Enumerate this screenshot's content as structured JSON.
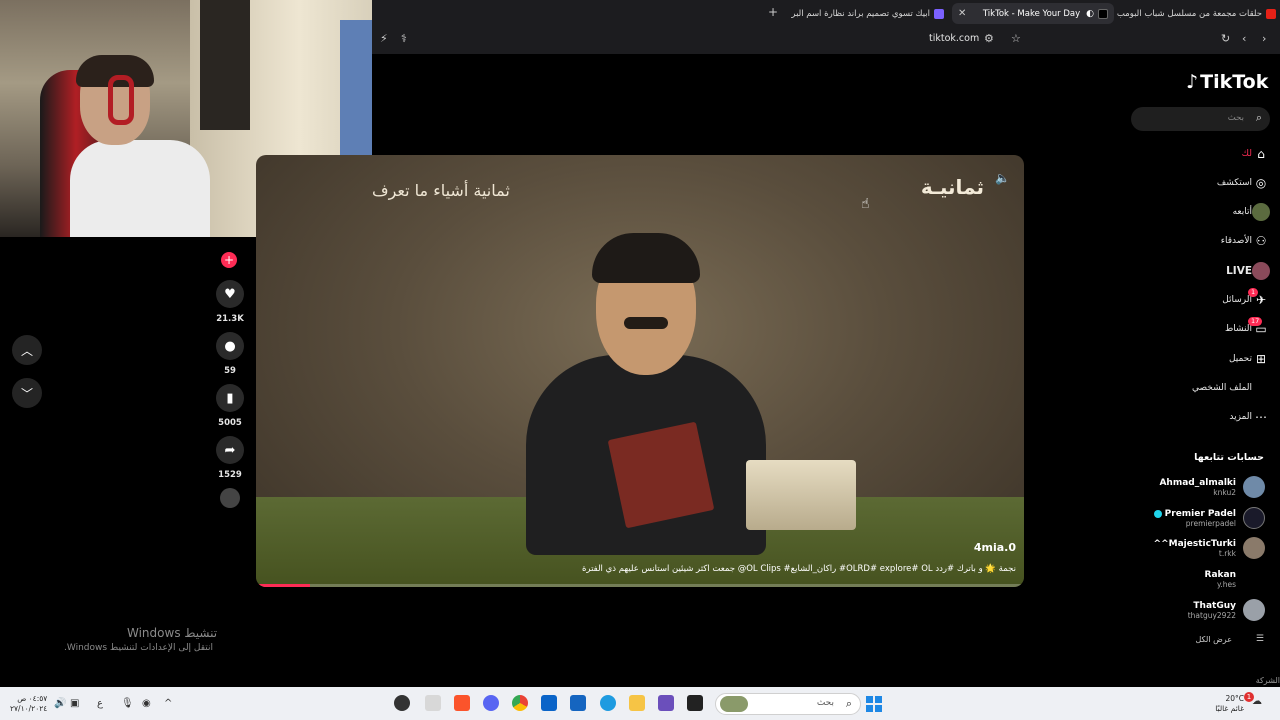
{
  "browser": {
    "tabs": [
      {
        "label": "حلقات مجمعة من مسلسل شباب البومب",
        "active": false
      },
      {
        "label": "TikTok - Make Your Day",
        "active": true
      },
      {
        "label": "ابيك تسوي تصميم براند نظارة اسم البر",
        "active": false
      }
    ],
    "new_tab": "+",
    "url": "tiktok.com"
  },
  "video": {
    "caption_left": "ثمانية أشياء ما تعرف",
    "caption_right": "ثمانيـة",
    "author": "4mia.0",
    "description": "نجمة 🌟 و باترك #ردد OLRD# explore# OL# راكان_الشايع# OL Clips@ جمعت اكثر شيئين استانس عليهم ذي الفترة",
    "progress": 0.07
  },
  "actions": {
    "likes": "21.3K",
    "comments": "59",
    "saves": "5005",
    "shares": "1529"
  },
  "sidebar": {
    "logo": "TikTok",
    "search_placeholder": "بحث",
    "nav": [
      {
        "label": "لك",
        "icon": "home-icon"
      },
      {
        "label": "استكشف",
        "icon": "compass-icon"
      },
      {
        "label": "أتابعه",
        "icon": "following-avatar-icon"
      },
      {
        "label": "الأصدقاء",
        "icon": "friends-icon"
      },
      {
        "label": "LIVE",
        "icon": "live-icon"
      },
      {
        "label": "الرسائل",
        "icon": "messages-icon",
        "badge": "1"
      },
      {
        "label": "النشاط",
        "icon": "inbox-icon",
        "badge": "17"
      },
      {
        "label": "تحميل",
        "icon": "upload-icon"
      },
      {
        "label": "الملف الشخصي",
        "icon": "profile-icon"
      },
      {
        "label": "المزيد",
        "icon": "more-icon"
      }
    ],
    "following_title": "حسابات تتابعها",
    "accounts": [
      {
        "name": "Ahmad_almalki",
        "handle": "knku2"
      },
      {
        "name": "Premier Padel",
        "handle": "premierpadel"
      },
      {
        "name": "^^MajesticTurki",
        "handle": "t.rkk"
      },
      {
        "name": "Rakan",
        "handle": "y.hes"
      },
      {
        "name": "ThatGuy",
        "handle": "thatguy2922"
      }
    ],
    "show_all": "عرض الكل",
    "company": "الشركة"
  },
  "windows": {
    "activate_title": "تنشيط Windows",
    "activate_sub": "انتقل إلى الإعدادات لتنشيط Windows."
  },
  "taskbar": {
    "search_placeholder": "بحث",
    "time": "٠٤:٥٧ ص",
    "date": "٢٧/١٠/٢٠٢٤",
    "lang": "ع",
    "weather_temp": "20°C",
    "weather_desc": "غائم غالبًا",
    "notif_count": "1"
  }
}
